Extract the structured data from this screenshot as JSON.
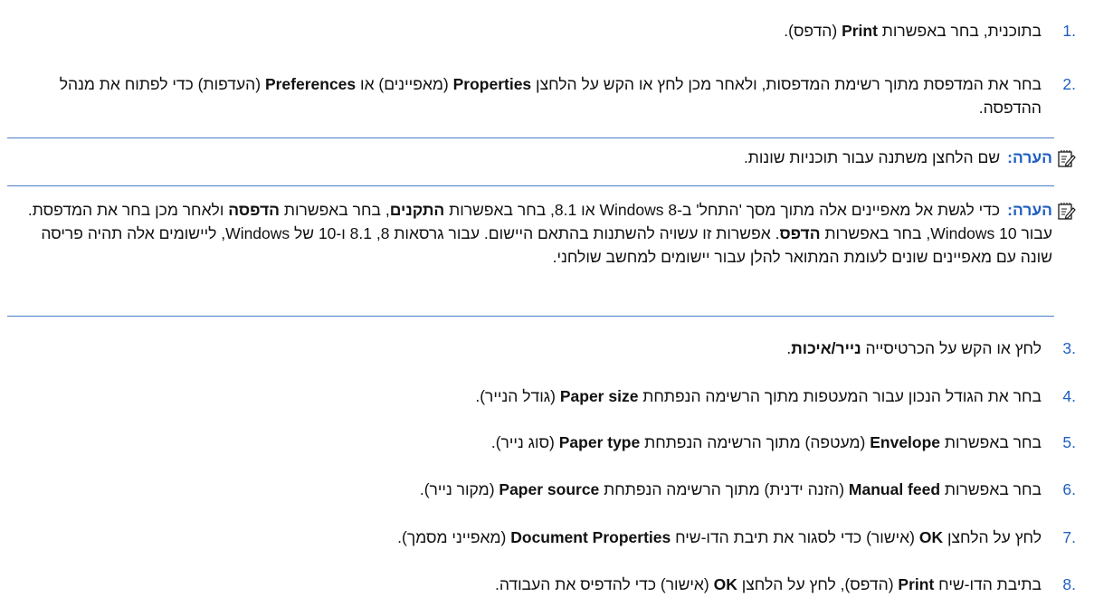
{
  "steps": [
    {
      "number": ".1",
      "parts": [
        "בתוכנית, בחר באפשרות ",
        "Print",
        " (הדפס)."
      ]
    },
    {
      "number": ".2",
      "parts": [
        "בחר את המדפסת מתוך רשימת המדפסות, ולאחר מכן לחץ או הקש על הלחצן ",
        "Properties",
        " (מאפיינים) או ",
        "Preferences",
        " (העדפות) כדי לפתוח את מנהל ההדפסה."
      ]
    },
    {
      "number": ".3",
      "parts": [
        "לחץ או הקש על הכרטיסייה ",
        "נייר/איכות",
        "."
      ]
    },
    {
      "number": ".4",
      "parts": [
        "בחר את הגודל הנכון עבור המעטפות מתוך הרשימה הנפתחת ",
        "Paper size",
        " (גודל הנייר)."
      ]
    },
    {
      "number": ".5",
      "parts": [
        "בחר באפשרות ",
        "Envelope",
        " (מעטפה) מתוך הרשימה הנפתחת ",
        "Paper type",
        " (סוג נייר)."
      ]
    },
    {
      "number": ".6",
      "parts": [
        "בחר באפשרות ",
        "Manual feed",
        " (הזנה ידנית) מתוך הרשימה הנפתחת ",
        "Paper source",
        " (מקור נייר)."
      ]
    },
    {
      "number": ".7",
      "parts": [
        "לחץ על הלחצן ",
        "OK",
        " (אישור) כדי לסגור את תיבת הדו-שיח ",
        "Document Properties",
        " (מאפייני מסמך)."
      ]
    },
    {
      "number": ".8",
      "parts": [
        "בתיבת הדו-שיח ",
        "Print",
        " (הדפס), לחץ על הלחצן ",
        "OK",
        " (אישור) כדי להדפיס את העבודה."
      ]
    }
  ],
  "notes": [
    {
      "label": "הערה:",
      "parts": [
        "שם הלחצן משתנה עבור תוכניות שונות."
      ]
    },
    {
      "label": "הערה:",
      "parts": [
        "כדי לגשת אל מאפיינים אלה מתוך מסך 'התחל' ב-Windows 8 או 8.1, בחר באפשרות ",
        "התקנים",
        ", בחר באפשרות ",
        "הדפסה",
        " ולאחר מכן בחר את המדפסת. עבור Windows 10, בחר באפשרות ",
        "הדפס",
        ". אפשרות זו עשויה להשתנות בהתאם היישום. עבור גרסאות 8, 8.1 ו-10 של Windows, ליישומים אלה תהיה פריסה שונה עם מאפיינים שונים לעומת המתואר להלן עבור יישומים למחשב שולחני."
      ]
    }
  ],
  "colors": {
    "accent": "#1f5fbf",
    "rule": "#4a7fc7",
    "text": "#111111"
  },
  "icons": {
    "note": "note-pencil-icon"
  }
}
